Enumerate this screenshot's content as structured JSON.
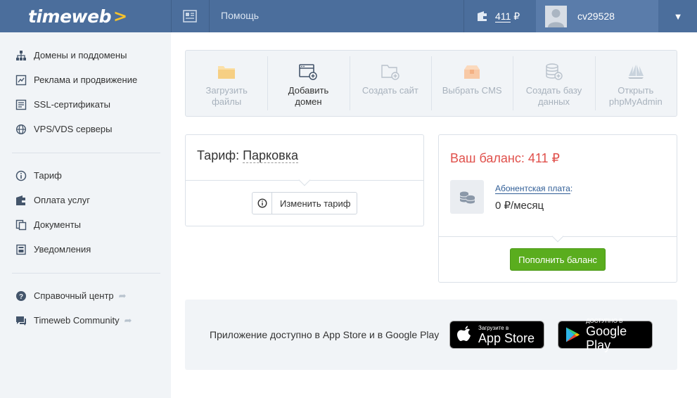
{
  "header": {
    "logo": "timeweb",
    "help_label": "Помощь",
    "balance": "411",
    "currency": "₽",
    "username": "cv29528"
  },
  "sidebar": {
    "group1": [
      {
        "label": "Домены и поддомены",
        "icon": "sitemap-icon"
      },
      {
        "label": "Реклама и продвижение",
        "icon": "chart-icon"
      },
      {
        "label": "SSL-сертификаты",
        "icon": "certificate-icon"
      },
      {
        "label": "VPS/VDS серверы",
        "icon": "server-icon"
      }
    ],
    "group2": [
      {
        "label": "Тариф",
        "icon": "info-icon"
      },
      {
        "label": "Оплата услуг",
        "icon": "wallet-icon"
      },
      {
        "label": "Документы",
        "icon": "documents-icon"
      },
      {
        "label": "Уведомления",
        "icon": "notification-icon"
      }
    ],
    "group3": [
      {
        "label": "Справочный центр",
        "icon": "help-icon"
      },
      {
        "label": "Timeweb Community",
        "icon": "chat-icon"
      }
    ]
  },
  "quick_actions": [
    {
      "label": "Загрузить\nфайлы",
      "icon": "folder-icon",
      "active": false
    },
    {
      "label": "Добавить\nдомен",
      "icon": "add-domain-icon",
      "active": true
    },
    {
      "label": "Создать сайт",
      "icon": "add-folder-icon",
      "active": false
    },
    {
      "label": "Выбрать CMS",
      "icon": "cms-box-icon",
      "active": false
    },
    {
      "label": "Создать базу\nданных",
      "icon": "database-icon",
      "active": false
    },
    {
      "label": "Открыть\nphpMyAdmin",
      "icon": "phpmyadmin-icon",
      "active": false
    }
  ],
  "tariff": {
    "prefix": "Тариф:",
    "value": "Парковка",
    "change_label": "Изменить тариф"
  },
  "balance": {
    "title": "Ваш баланс: 411 ₽",
    "fee_label": "Абонентская плата",
    "fee_colon": ":",
    "fee_value": "0 ₽/месяц",
    "topup_label": "Пополнить баланс"
  },
  "apps": {
    "text": "Приложение доступно в App Store и в Google Play",
    "appstore_small": "Загрузите в",
    "appstore_big": "App Store",
    "gplay_small": "ДОСТУПНО В",
    "gplay_big": "Google Play"
  },
  "colors": {
    "header": "#4b6e9c",
    "sidebar": "#f1f4f7",
    "balance_red": "#e0504b",
    "topup_green": "#5aad1e",
    "link_blue": "#2f5d96"
  }
}
